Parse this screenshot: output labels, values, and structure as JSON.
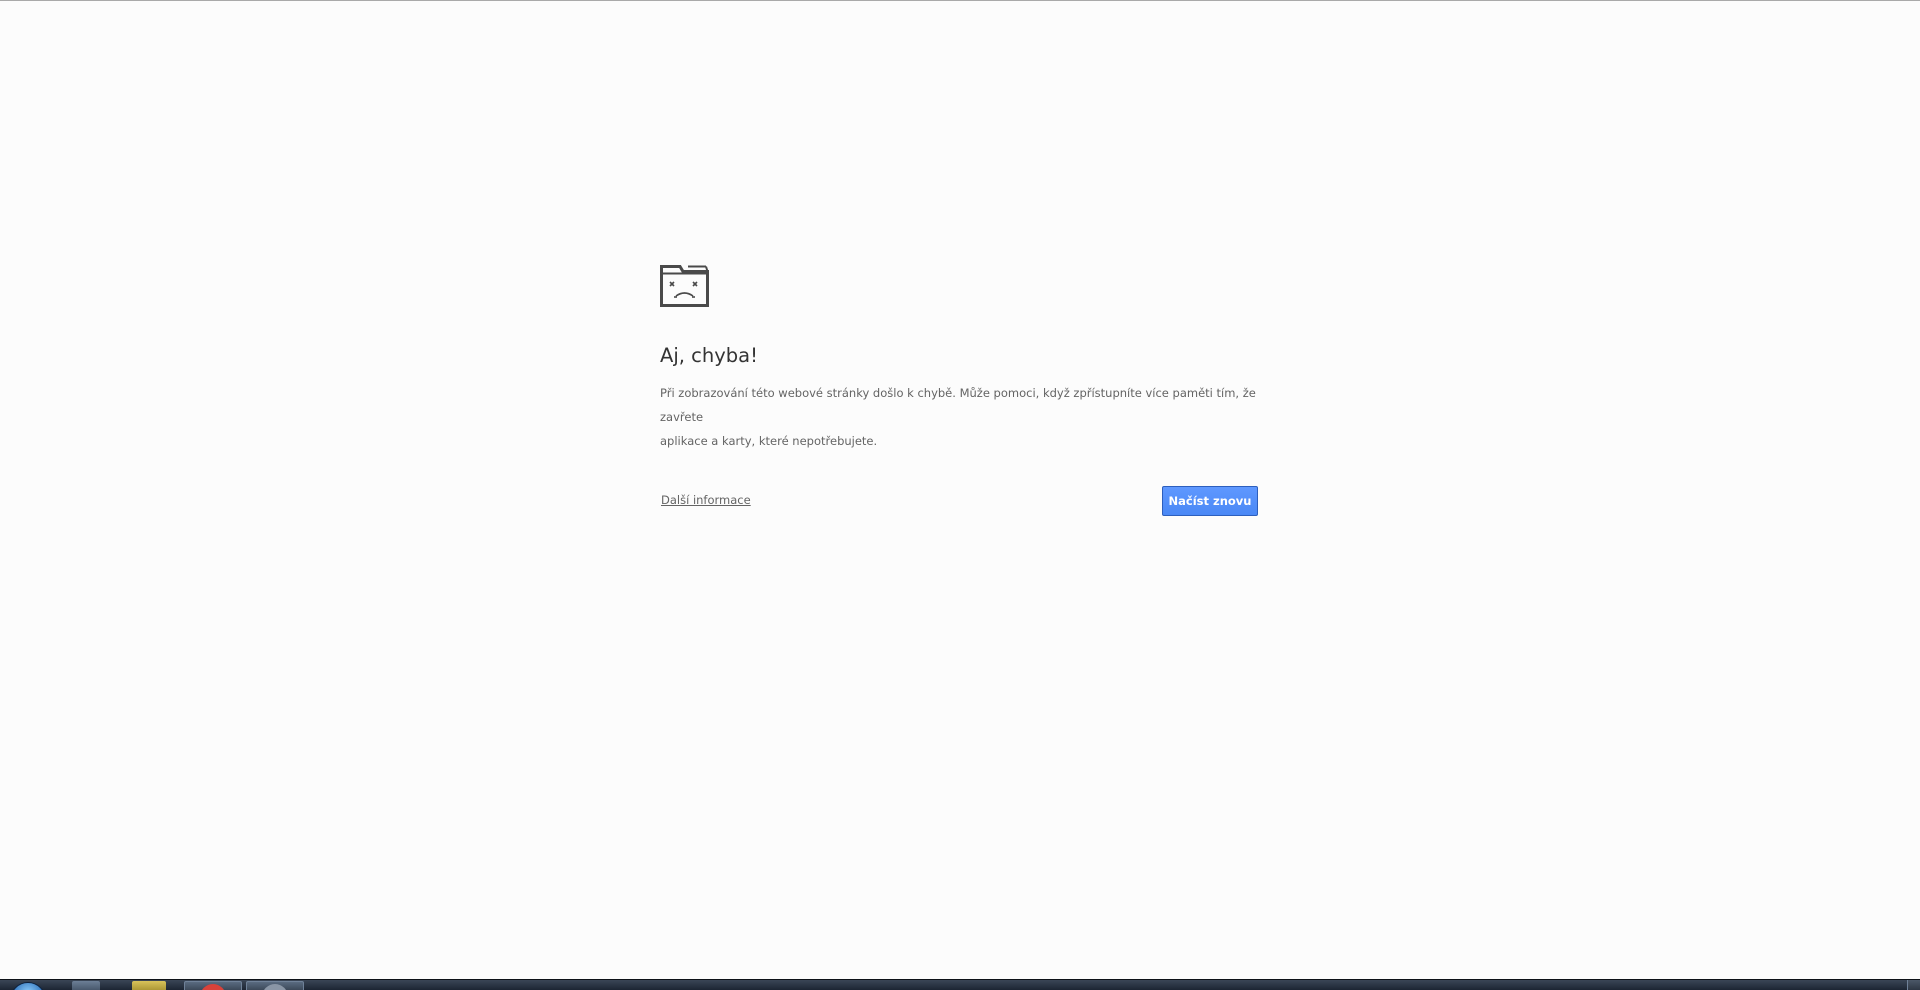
{
  "error_page": {
    "icon": "sad-tab-icon",
    "title": "Aj, chyba!",
    "message_line1": "Při zobrazování této webové stránky došlo k chybě. Může pomoci, když zpřístupníte více paměti tím, že zavřete",
    "message_line2": "aplikace a karty, které nepotřebujete.",
    "more_info_label": "Další informace",
    "reload_label": "Načíst znovu"
  },
  "colors": {
    "background": "#fcfcfc",
    "title": "#333333",
    "text": "#646464",
    "button": "#4d90fe",
    "button_border": "#2d5fbd"
  },
  "taskbar": {
    "items": [
      {
        "name": "start-button",
        "icon": "windows-orb-icon"
      },
      {
        "name": "internet-explorer",
        "icon": "ie-icon"
      },
      {
        "name": "file-explorer",
        "icon": "folder-icon"
      },
      {
        "name": "chrome",
        "icon": "chrome-icon",
        "active": true
      },
      {
        "name": "other-app",
        "icon": "app-icon"
      }
    ]
  }
}
